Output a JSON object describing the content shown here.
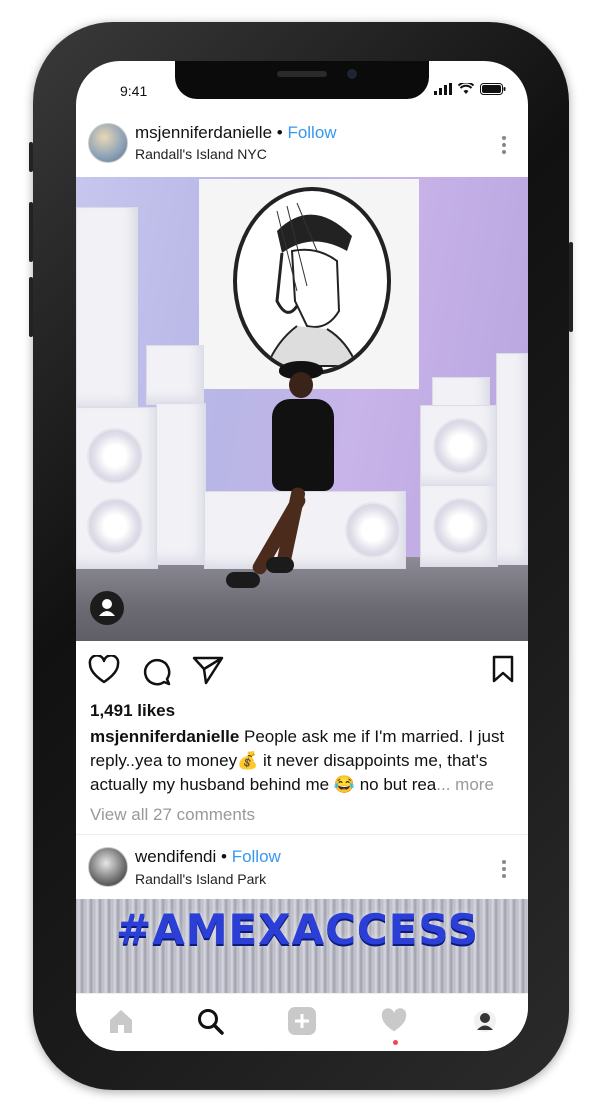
{
  "status_bar": {
    "time": "9:41"
  },
  "post": {
    "username": "msjenniferdanielle",
    "follow_separator": " • ",
    "follow_label": "Follow",
    "location": "Randall's Island NYC",
    "likes": "1,491 likes",
    "caption_username": "msjenniferdanielle",
    "caption_text": " People ask me if I'm married. I just reply..yea to money💰 it never disappoints me, that's actually my husband behind me 😂 no but rea",
    "caption_ellipsis": "... ",
    "more_label": "more",
    "view_comments": "View all 27 comments"
  },
  "post2": {
    "username": "wendifendi",
    "follow_separator": " • ",
    "follow_label": "Follow",
    "location": "Randall's Island Park",
    "image_text": "#AMEXACCESS"
  },
  "tabbar": {
    "items": [
      "home-icon",
      "search-icon",
      "new-post-icon",
      "activity-heart-icon",
      "profile-avatar"
    ]
  },
  "colors": {
    "follow_blue": "#3897f0",
    "notification_red": "#ed4956",
    "muted_gray": "#999999"
  }
}
